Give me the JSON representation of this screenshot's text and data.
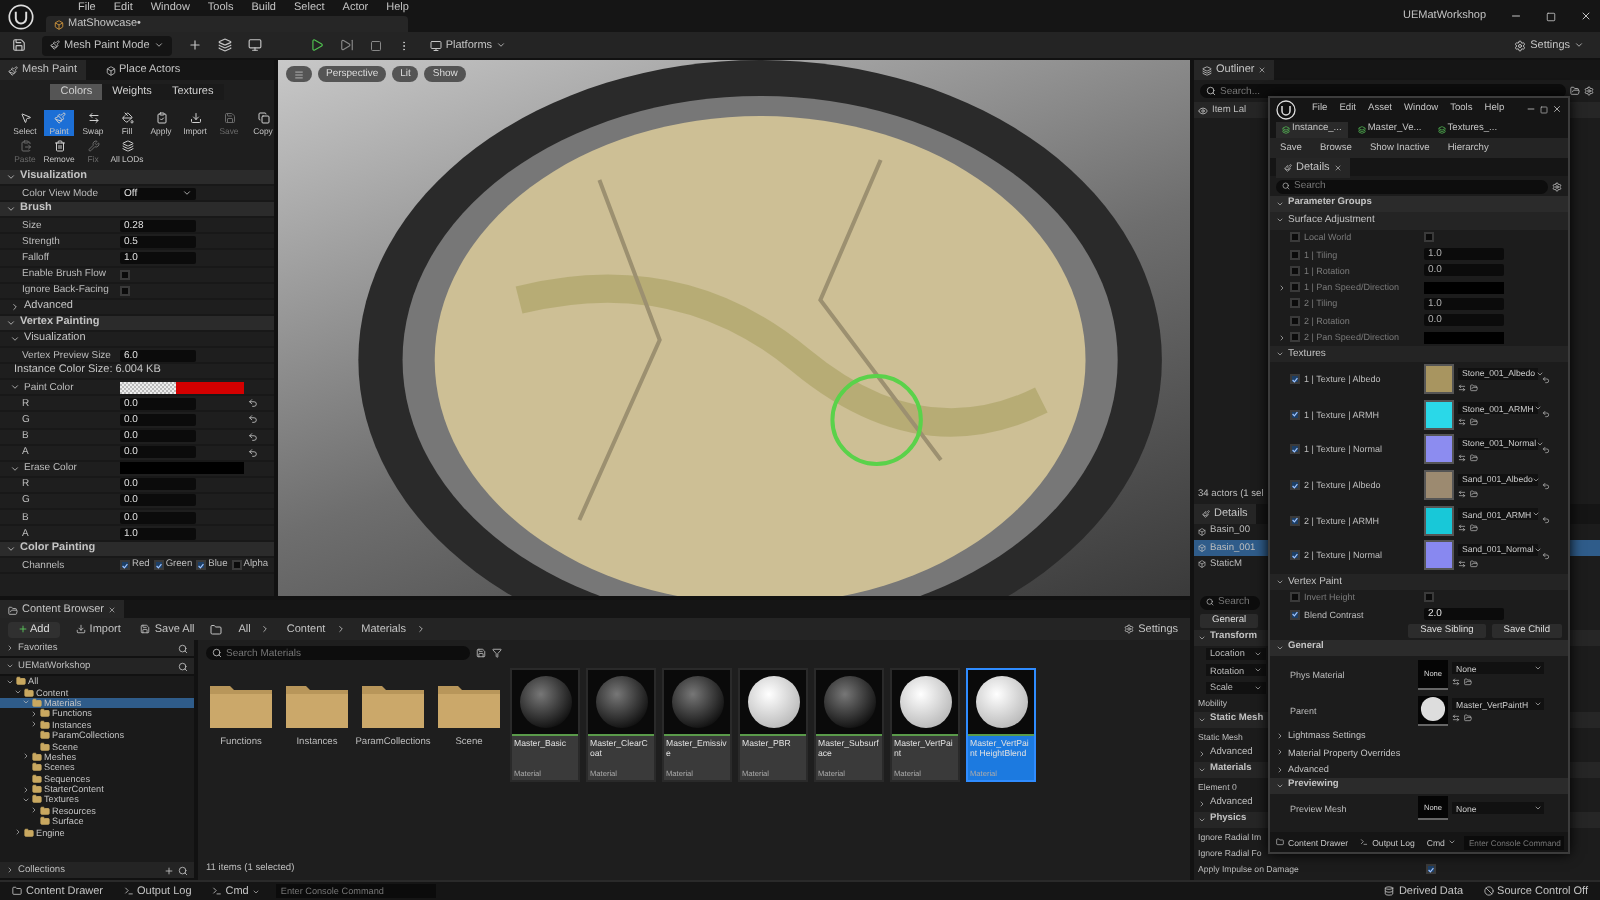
{
  "menu_bar": {
    "items": [
      "File",
      "Edit",
      "Window",
      "Tools",
      "Build",
      "Select",
      "Actor",
      "Help"
    ],
    "level_tab": "MatShowcase•",
    "app_title": "UEMatWorkshop"
  },
  "toolbar": {
    "mode": "Mesh Paint Mode",
    "platforms": "Platforms",
    "settings": "Settings"
  },
  "viewport": {
    "buttons": [
      "Perspective",
      "Lit",
      "Show"
    ]
  },
  "mesh_paint": {
    "tabs": [
      {
        "label": "Mesh Paint",
        "selected": true
      },
      {
        "label": "Place Actors",
        "selected": false
      }
    ],
    "modes": [
      {
        "label": "Colors",
        "selected": true
      },
      {
        "label": "Weights",
        "selected": false
      },
      {
        "label": "Textures",
        "selected": false
      }
    ],
    "tools": [
      {
        "label": "Select",
        "selected": false,
        "disabled": false
      },
      {
        "label": "Paint",
        "selected": true,
        "disabled": false
      },
      {
        "label": "Swap",
        "selected": false,
        "disabled": false
      },
      {
        "label": "Fill",
        "selected": false,
        "disabled": false
      },
      {
        "label": "Apply",
        "selected": false,
        "disabled": false
      },
      {
        "label": "Import",
        "selected": false,
        "disabled": false
      },
      {
        "label": "Save",
        "selected": false,
        "disabled": true
      },
      {
        "label": "Copy",
        "selected": false,
        "disabled": false
      },
      {
        "label": "Paste",
        "selected": false,
        "disabled": true
      },
      {
        "label": "Remove",
        "selected": false,
        "disabled": false
      },
      {
        "label": "Fix",
        "selected": false,
        "disabled": true
      },
      {
        "label": "All LODs",
        "selected": false,
        "disabled": false
      }
    ],
    "properties": [
      {
        "kind": "section",
        "label": "Visualization",
        "expanded": true
      },
      {
        "kind": "dropdown",
        "label": "Color View Mode",
        "value": "Off"
      },
      {
        "kind": "section",
        "label": "Brush",
        "expanded": true
      },
      {
        "kind": "field",
        "label": "Size",
        "value": "0.28",
        "reset": false
      },
      {
        "kind": "field",
        "label": "Strength",
        "value": "0.5",
        "reset": false
      },
      {
        "kind": "field",
        "label": "Falloff",
        "value": "1.0",
        "reset": false
      },
      {
        "kind": "check",
        "label": "Enable Brush Flow",
        "checked": false
      },
      {
        "kind": "check",
        "label": "Ignore Back-Facing",
        "checked": false
      },
      {
        "kind": "group",
        "label": "Advanced",
        "expanded": false
      },
      {
        "kind": "section",
        "label": "Vertex Painting",
        "expanded": true
      },
      {
        "kind": "group",
        "label": "Visualization",
        "expanded": true
      },
      {
        "kind": "field",
        "label": "Vertex Preview Size",
        "value": "6.0",
        "reset": false
      },
      {
        "kind": "note",
        "label": "Instance Color Size: 6.004 KB"
      },
      {
        "kind": "color",
        "label": "Paint Color",
        "color": "#d40000",
        "checker": true
      },
      {
        "kind": "field",
        "label": "R",
        "value": "0.0",
        "reset": true
      },
      {
        "kind": "field",
        "label": "G",
        "value": "0.0",
        "reset": true
      },
      {
        "kind": "field",
        "label": "B",
        "value": "0.0",
        "reset": true
      },
      {
        "kind": "field",
        "label": "A",
        "value": "0.0",
        "reset": true
      },
      {
        "kind": "color",
        "label": "Erase Color",
        "color": "#000000",
        "checker": false
      },
      {
        "kind": "field",
        "label": "R",
        "value": "0.0",
        "reset": false
      },
      {
        "kind": "field",
        "label": "G",
        "value": "0.0",
        "reset": false
      },
      {
        "kind": "field",
        "label": "B",
        "value": "0.0",
        "reset": false
      },
      {
        "kind": "field",
        "label": "A",
        "value": "1.0",
        "reset": false
      },
      {
        "kind": "section",
        "label": "Color Painting",
        "expanded": true
      },
      {
        "kind": "channels",
        "label": "Channels",
        "channels": [
          {
            "label": "Red",
            "checked": true
          },
          {
            "label": "Green",
            "checked": true
          },
          {
            "label": "Blue",
            "checked": true
          },
          {
            "label": "Alpha",
            "checked": false
          }
        ]
      }
    ]
  },
  "content_browser": {
    "tab": "Content Browser",
    "add": "Add",
    "import": "Import",
    "save_all": "Save All",
    "path": [
      "All",
      "Content",
      "Materials"
    ],
    "settings": "Settings",
    "favorites": "Favorites",
    "project": "UEMatWorkshop",
    "tree": [
      {
        "label": "All",
        "kind": "branch",
        "expanded": true,
        "selected": false,
        "children": [
          {
            "label": "Content",
            "kind": "branch",
            "expanded": true,
            "selected": false,
            "children": [
              {
                "label": "Materials",
                "kind": "branch",
                "expanded": true,
                "selected": true,
                "children": [
                  {
                    "label": "Functions",
                    "kind": "branch",
                    "expanded": false,
                    "selected": false
                  },
                  {
                    "label": "Instances",
                    "kind": "branch",
                    "expanded": false,
                    "selected": false
                  },
                  {
                    "label": "ParamCollections",
                    "kind": "leaf",
                    "selected": false
                  },
                  {
                    "label": "Scene",
                    "kind": "leaf",
                    "selected": false
                  }
                ]
              },
              {
                "label": "Meshes",
                "kind": "branch",
                "expanded": false,
                "selected": false
              },
              {
                "label": "Scenes",
                "kind": "leaf",
                "selected": false
              },
              {
                "label": "Sequences",
                "kind": "leaf",
                "selected": false
              },
              {
                "label": "StarterContent",
                "kind": "branch",
                "expanded": false,
                "selected": false
              },
              {
                "label": "Textures",
                "kind": "branch",
                "expanded": true,
                "selected": false,
                "children": [
                  {
                    "label": "Resources",
                    "kind": "branch",
                    "expanded": false,
                    "selected": false
                  },
                  {
                    "label": "Surface",
                    "kind": "leaf",
                    "selected": false
                  }
                ]
              }
            ]
          },
          {
            "label": "Engine",
            "kind": "branch",
            "expanded": false,
            "selected": false
          }
        ]
      }
    ],
    "collections": "Collections",
    "search_placeholder": "Search Materials",
    "assets": [
      {
        "kind": "folder",
        "name": "Functions",
        "selected": false
      },
      {
        "kind": "folder",
        "name": "Instances",
        "selected": false
      },
      {
        "kind": "folder",
        "name": "ParamCollections",
        "selected": false
      },
      {
        "kind": "folder",
        "name": "Scene",
        "selected": false
      },
      {
        "kind": "material",
        "name": "Master_Basic",
        "type": "Material",
        "white_sphere": false,
        "selected": false
      },
      {
        "kind": "material",
        "name": "Master_ClearCoat",
        "type": "Material",
        "white_sphere": false,
        "selected": false
      },
      {
        "kind": "material",
        "name": "Master_Emissive",
        "type": "Material",
        "white_sphere": false,
        "selected": false
      },
      {
        "kind": "material",
        "name": "Master_PBR",
        "type": "Material",
        "white_sphere": true,
        "selected": false
      },
      {
        "kind": "material",
        "name": "Master_Subsurface",
        "type": "Material",
        "white_sphere": false,
        "selected": false
      },
      {
        "kind": "material",
        "name": "Master_VertPaint",
        "type": "Material",
        "white_sphere": true,
        "selected": false
      },
      {
        "kind": "material",
        "name": "Master_VertPaint HeightBlend",
        "type": "Material",
        "white_sphere": true,
        "selected": true
      }
    ],
    "status": "11 items (1 selected)"
  },
  "outliner": {
    "tab": "Outliner",
    "search_placeholder": "Search...",
    "column": "Item Lal",
    "count": "34 actors (1 sel",
    "details_tab": "Details",
    "actors": [
      {
        "label": "Basin_00",
        "selected": false
      },
      {
        "label": "Basin_001",
        "selected": true
      },
      {
        "label": "StaticM",
        "selected": false
      }
    ],
    "details_search": "Search",
    "filter": "General",
    "rows": [
      {
        "kind": "section",
        "label": "Transform"
      },
      {
        "kind": "dropdown",
        "label": "Location"
      },
      {
        "kind": "dropdown",
        "label": "Rotation"
      },
      {
        "kind": "dropdown",
        "label": "Scale"
      },
      {
        "kind": "prop",
        "label": "Mobility"
      },
      {
        "kind": "section",
        "label": "Static Mesh"
      },
      {
        "kind": "prop",
        "label": "Static Mesh"
      },
      {
        "kind": "group",
        "label": "Advanced"
      },
      {
        "kind": "section",
        "label": "Materials"
      },
      {
        "kind": "prop",
        "label": "Element 0"
      },
      {
        "kind": "group",
        "label": "Advanced"
      },
      {
        "kind": "section",
        "label": "Physics"
      },
      {
        "kind": "prop",
        "label": "Ignore Radial Im"
      },
      {
        "kind": "prop",
        "label": "Ignore Radial Fo"
      },
      {
        "kind": "check",
        "label": "Apply Impulse on Damage",
        "checked": true
      }
    ]
  },
  "material_window": {
    "menus": [
      "File",
      "Edit",
      "Asset",
      "Window",
      "Tools",
      "Help"
    ],
    "tabs": [
      {
        "label": "Instance_...",
        "selected": true
      },
      {
        "label": "Master_Ve...",
        "selected": false
      },
      {
        "label": "Textures_...",
        "selected": false
      }
    ],
    "toolbar": [
      "Save",
      "Browse",
      "Show Inactive",
      "Hierarchy"
    ],
    "details_tab": "Details",
    "search_placeholder": "Search",
    "param_groups": "Parameter Groups",
    "groups": [
      {
        "label": "Surface Adjustment",
        "params": [
          {
            "kind": "bool",
            "label": "Local World",
            "enabled": false,
            "checked": false
          },
          {
            "kind": "scalar",
            "label": "1 | Tiling",
            "enabled": false,
            "value": "1.0"
          },
          {
            "kind": "scalar",
            "label": "1 | Rotation",
            "enabled": false,
            "value": "0.0"
          },
          {
            "kind": "color",
            "label": "1 | Pan Speed/Direction",
            "enabled": false,
            "color": "#000000"
          },
          {
            "kind": "scalar",
            "label": "2 | Tiling",
            "enabled": false,
            "value": "1.0"
          },
          {
            "kind": "scalar",
            "label": "2 | Rotation",
            "enabled": false,
            "value": "0.0"
          },
          {
            "kind": "color",
            "label": "2 | Pan Speed/Direction",
            "enabled": false,
            "color": "#000000"
          }
        ]
      },
      {
        "label": "Textures",
        "params": [
          {
            "kind": "texture",
            "label": "1 | Texture | Albedo",
            "enabled": true,
            "asset": "Stone_001_Albedo",
            "color": "#a89560"
          },
          {
            "kind": "texture",
            "label": "1 | Texture | ARMH",
            "enabled": true,
            "asset": "Stone_001_ARMH",
            "color": "#2ad8e8"
          },
          {
            "kind": "texture",
            "label": "1 | Texture | Normal",
            "enabled": true,
            "asset": "Stone_001_Normal",
            "color": "#8c8cf0"
          },
          {
            "kind": "texture",
            "label": "2 | Texture | Albedo",
            "enabled": true,
            "asset": "Sand_001_Albedo",
            "color": "#9c8a70"
          },
          {
            "kind": "texture",
            "label": "2 | Texture | ARMH",
            "enabled": true,
            "asset": "Sand_001_ARMH",
            "color": "#18c8d8"
          },
          {
            "kind": "texture",
            "label": "2 | Texture | Normal",
            "enabled": true,
            "asset": "Sand_001_Normal",
            "color": "#8888f0"
          }
        ]
      },
      {
        "label": "Vertex Paint",
        "params": [
          {
            "kind": "bool",
            "label": "Invert Height",
            "enabled": false,
            "checked": false
          },
          {
            "kind": "scalar",
            "label": "Blend Contrast",
            "enabled": true,
            "value": "2.0"
          }
        ]
      }
    ],
    "save_buttons": [
      "Save Sibling",
      "Save Child"
    ],
    "general": {
      "label": "General",
      "slots": [
        {
          "label": "Phys Material",
          "thumb": "None",
          "asset": "None",
          "sphere": false
        },
        {
          "label": "Parent",
          "asset": "Master_VertPaintH",
          "sphere": true
        }
      ],
      "collapsed": [
        "Lightmass Settings",
        "Material Property Overrides",
        "Advanced"
      ]
    },
    "previewing": {
      "label": "Previewing",
      "slot": {
        "label": "Preview Mesh",
        "thumb": "None",
        "asset": "None"
      }
    },
    "bottom_bar": {
      "content_drawer": "Content Drawer",
      "output_log": "Output Log",
      "cmd": "Cmd",
      "console_placeholder": "Enter Console Command"
    }
  },
  "status_bar": {
    "content_drawer": "Content Drawer",
    "output_log": "Output Log",
    "cmd": "Cmd",
    "console_placeholder": "Enter Console Command",
    "derived_data": "Derived Data",
    "source_control": "Source Control Off"
  }
}
